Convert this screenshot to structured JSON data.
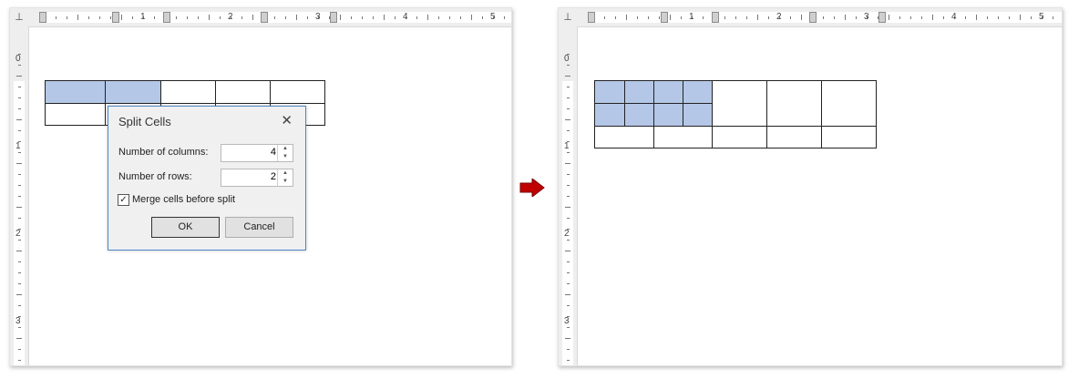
{
  "ruler": {
    "tab_selector_glyph": "⊥",
    "h_numbers": [
      "1",
      "2",
      "3",
      "4",
      "5"
    ],
    "v_numbers": [
      "0",
      "1",
      "2",
      "3"
    ]
  },
  "dialog": {
    "title": "Split Cells",
    "close_glyph": "✕",
    "columns_label": "Number of columns:",
    "columns_value": "4",
    "rows_label": "Number of rows:",
    "rows_value": "2",
    "merge_label": "Merge cells before split",
    "merge_checked": true,
    "check_glyph": "✓",
    "ok_label": "OK",
    "cancel_label": "Cancel"
  },
  "arrow": {
    "color": "#c00000",
    "icon": "right-arrow-icon"
  },
  "colors": {
    "selected_cell": "#b4c7e7",
    "dialog_border": "#4a86c8"
  }
}
